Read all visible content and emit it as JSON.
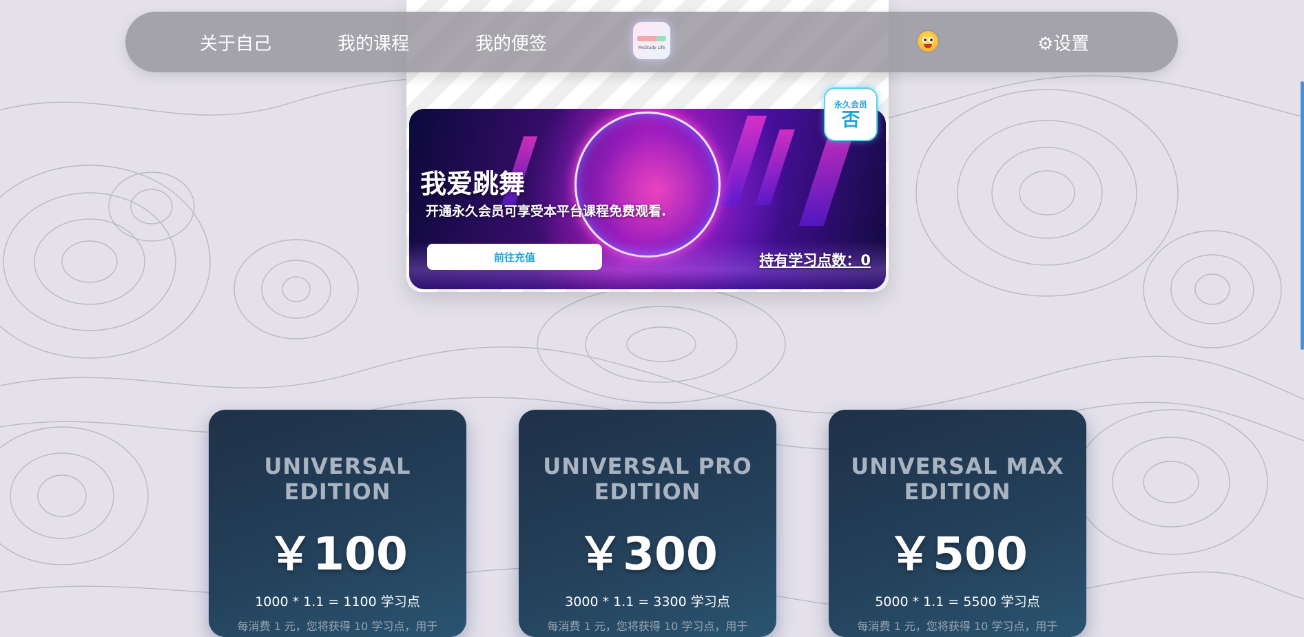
{
  "nav": {
    "about": "关于自己",
    "courses": "我的课程",
    "notes": "我的便签",
    "logo_text": "MeStudy Life",
    "settings": "⚙设置"
  },
  "banner": {
    "title": "我爱跳舞",
    "subtitle": "开通永久会员可享受本平台课程免费观看.",
    "recharge_label": "前往充值",
    "points_label": "持有学习点数：0"
  },
  "vip": {
    "label": "永久会员",
    "value": "否"
  },
  "plans": [
    {
      "title": "UNIVERSAL EDITION",
      "price": "￥100",
      "formula": "1000 * 1.1 = 1100 学习点",
      "desc": "每消费 1 元，您将获得 10 学习点，用于"
    },
    {
      "title": "UNIVERSAL PRO EDITION",
      "price": "￥300",
      "formula": "3000 * 1.1 = 3300 学习点",
      "desc": "每消费 1 元，您将获得 10 学习点，用于"
    },
    {
      "title": "UNIVERSAL MAX EDITION",
      "price": "￥500",
      "formula": "5000 * 1.1 = 5500 学习点",
      "desc": "每消费 1 元，您将获得 10 学习点，用于"
    }
  ],
  "colors": {
    "accent": "#1aa7d3",
    "card_bg": "#24405a",
    "page_bg": "#e4e1eb"
  }
}
